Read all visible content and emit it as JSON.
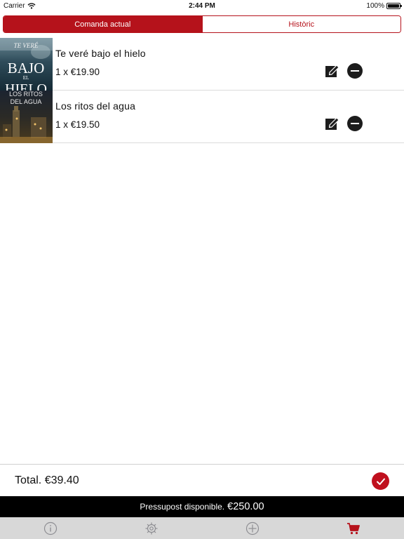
{
  "status_bar": {
    "carrier": "Carrier",
    "time": "2:44 PM",
    "battery": "100%",
    "battery_level": 1.0,
    "icons": [
      "wifi-icon",
      "battery-icon"
    ]
  },
  "segmented_control": {
    "tabs": [
      {
        "label": "Comanda actual",
        "active": true
      },
      {
        "label": "Històric",
        "active": false
      }
    ]
  },
  "order": {
    "items": [
      {
        "title": "Te veré bajo el hielo",
        "qty_price": "1 x €19.90",
        "cover": {
          "line1": "TE VERÉ",
          "line2": "BAJO",
          "line3": "EL",
          "line4": "HIELO"
        }
      },
      {
        "title": "Los ritos del agua",
        "qty_price": "1 x €19.50",
        "cover": {
          "line1": "LOS RITOS",
          "line2": "DEL AGUA"
        }
      }
    ],
    "item_icons": [
      "edit-icon",
      "remove-icon"
    ]
  },
  "total": {
    "text": "Total. €39.40",
    "confirm_icon": "checkmark-icon"
  },
  "budget": {
    "label": "Pressupost disponible.",
    "amount": "€250.00"
  },
  "tab_bar": {
    "tabs": [
      {
        "icon": "info-icon",
        "active": false
      },
      {
        "icon": "gear-icon",
        "active": false
      },
      {
        "icon": "add-icon",
        "active": false
      },
      {
        "icon": "cart-icon",
        "active": true
      }
    ]
  },
  "colors": {
    "accent": "#b5121b",
    "confirm": "#c0101e",
    "budget_bar": "#000000",
    "tab_bar": "#d8d8d8",
    "icon_inactive": "#8e8e93"
  }
}
